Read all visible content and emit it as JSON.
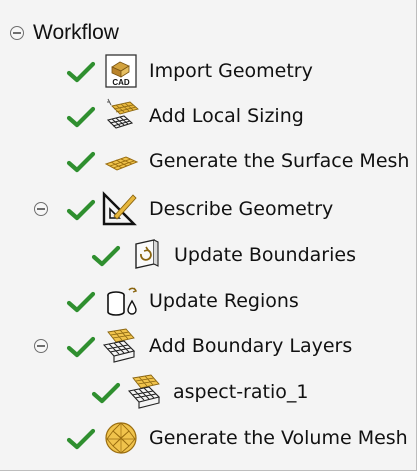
{
  "workflow": {
    "title": "Workflow",
    "collapse_icon": "minus-circle-icon",
    "check_icon": "checkmark-icon",
    "check_color": "#2f8f2f",
    "items": [
      {
        "label": "Import Geometry",
        "icon": "cad-box-icon",
        "done": true,
        "expandable": false
      },
      {
        "label": "Add Local Sizing",
        "icon": "mesh-grid-icon",
        "done": true,
        "expandable": false
      },
      {
        "label": "Generate the Surface Mesh",
        "icon": "surface-mesh-icon",
        "done": true,
        "expandable": false
      },
      {
        "label": "Describe Geometry",
        "icon": "geometry-ruler-icon",
        "done": true,
        "expandable": true
      },
      {
        "label": "Update Boundaries",
        "icon": "boundary-panel-icon",
        "done": true,
        "expandable": false
      },
      {
        "label": "Update Regions",
        "icon": "regions-cylinder-icon",
        "done": true,
        "expandable": false
      },
      {
        "label": "Add Boundary Layers",
        "icon": "boundary-layers-icon",
        "done": true,
        "expandable": true
      },
      {
        "label": "aspect-ratio_1",
        "icon": "boundary-layers-icon",
        "done": true,
        "expandable": false
      },
      {
        "label": "Generate the Volume Mesh",
        "icon": "volume-mesh-sphere-icon",
        "done": true,
        "expandable": false
      }
    ]
  }
}
